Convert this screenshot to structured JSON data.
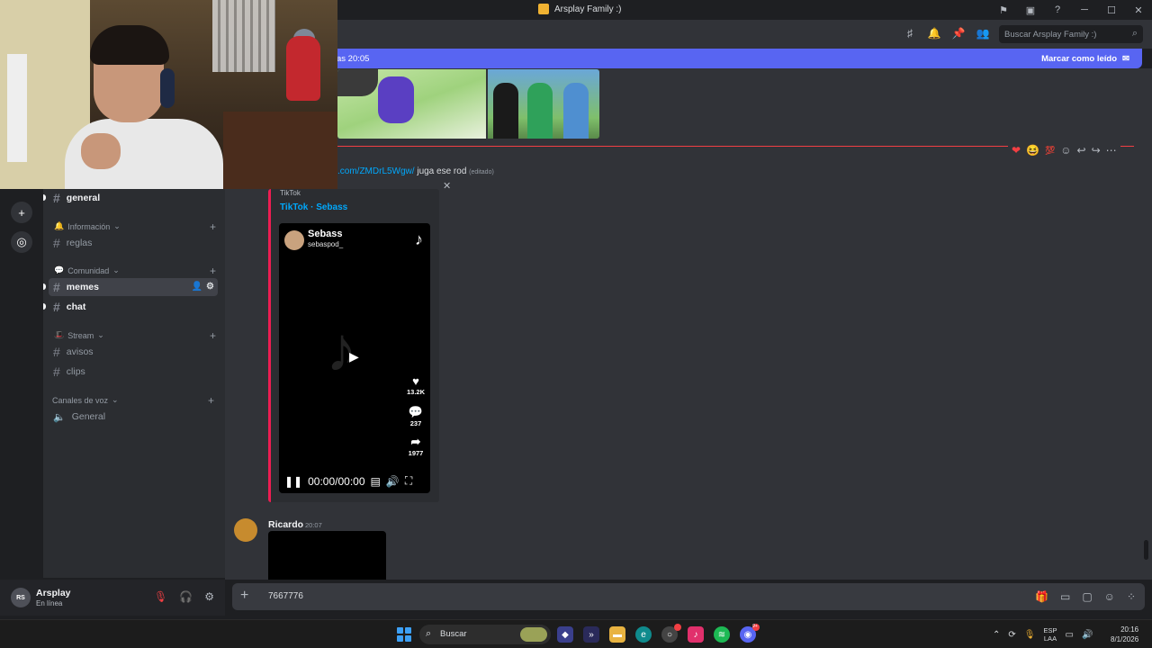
{
  "window": {
    "title": "Arsplay Family :)",
    "buttons": [
      "─",
      "☐",
      "✕"
    ]
  },
  "header": {
    "search_placeholder": "Buscar Arsplay Family :)"
  },
  "new_messages_bar": {
    "text": "as 20:05",
    "action": "Marcar como leído"
  },
  "sidebar": {
    "categories": [
      {
        "label": "Información",
        "icon": "bell-icon"
      },
      {
        "label": "Comunidad",
        "icon": "speech-icon"
      },
      {
        "label": "Stream",
        "icon": "hat-icon"
      },
      {
        "label": "Canales de voz",
        "icon": ""
      }
    ],
    "channels": {
      "general": "general",
      "reglas": "reglas",
      "memes": "memes",
      "chat": "chat",
      "avisos": "avisos",
      "clips": "clips",
      "voice_general": "General"
    }
  },
  "user": {
    "initials": "RS",
    "name": "Arsplay",
    "status": "En línea"
  },
  "message1": {
    "link": ".com/ZMDrL5Wgw/",
    "text": " juga ese rod ",
    "edited": "(editado)"
  },
  "embed": {
    "provider": "TikTok",
    "author": "TikTok · Sebass",
    "video": {
      "name": "Sebass",
      "handle": "sebaspod_",
      "likes": "13.2K",
      "comments": "237",
      "shares": "1977",
      "time": "00:00/00:00"
    }
  },
  "message2": {
    "author": "Ricardo",
    "time": "20:07"
  },
  "composer": {
    "value": "7667776"
  },
  "taskbar": {
    "search": "Buscar",
    "lang1": "ESP",
    "lang2": "LAA",
    "time": "20:16",
    "date": "8/1/2026",
    "discord_badge": "9+"
  },
  "colors": {
    "accent": "#5865f2",
    "tiktok": "#ee1d52",
    "link": "#00a8fc",
    "unread": "#f23f43"
  }
}
